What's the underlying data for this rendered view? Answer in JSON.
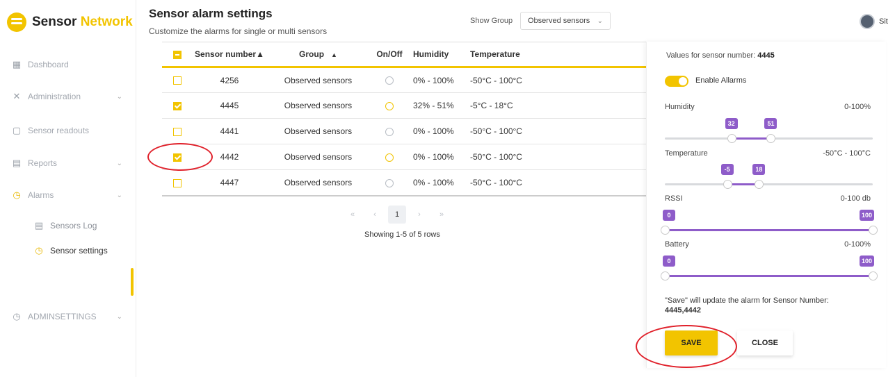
{
  "brand": {
    "name_a": "Sensor",
    "name_b": "Network",
    "accent_color": "#f2c400"
  },
  "sidebar": {
    "items": [
      {
        "label": "Dashboard",
        "icon": "dashboard-icon"
      },
      {
        "label": "Administration",
        "icon": "tools-icon"
      },
      {
        "label": "Sensor readouts",
        "icon": "chart-icon"
      },
      {
        "label": "Reports",
        "icon": "report-icon"
      },
      {
        "label": "Alarms",
        "icon": "alarm-icon"
      },
      {
        "label": "Sensors Log",
        "icon": "log-icon"
      },
      {
        "label": "Sensor settings",
        "icon": "alarm-settings-icon"
      },
      {
        "label": "ADMINSETTINGS",
        "icon": "alarm-icon"
      }
    ]
  },
  "header": {
    "title": "Sensor alarm settings",
    "subtitle": "Customize the alarms for single or multi sensors",
    "group_label": "Show Group",
    "group_value": "Observed sensors",
    "user_name": "Sit"
  },
  "table": {
    "columns": [
      "Sensor number▲",
      "Group",
      "On/Off",
      "Humidity",
      "Temperature"
    ],
    "sort_glyph": "▲",
    "rows": [
      {
        "checked": false,
        "number": "4256",
        "group": "Observed sensors",
        "alarm_on": false,
        "humidity": "0% - 100%",
        "temperature": "-50°C - 100°C"
      },
      {
        "checked": true,
        "number": "4445",
        "group": "Observed sensors",
        "alarm_on": true,
        "humidity": "32% - 51%",
        "temperature": "-5°C - 18°C"
      },
      {
        "checked": false,
        "number": "4441",
        "group": "Observed sensors",
        "alarm_on": false,
        "humidity": "0% - 100%",
        "temperature": "-50°C - 100°C"
      },
      {
        "checked": true,
        "number": "4442",
        "group": "Observed sensors",
        "alarm_on": true,
        "humidity": "0% - 100%",
        "temperature": "-50°C - 100°C"
      },
      {
        "checked": false,
        "number": "4447",
        "group": "Observed sensors",
        "alarm_on": false,
        "humidity": "0% - 100%",
        "temperature": "-50°C - 100°C"
      }
    ]
  },
  "pagination": {
    "first": "«",
    "prev": "‹",
    "current": "1",
    "next": "›",
    "last": "»",
    "showing": "Showing 1-5 of 5 rows"
  },
  "panel": {
    "values_label": "Values for sensor number: ",
    "values_number": "4445",
    "enable_label": "Enable Allarms",
    "enable_on": true,
    "humidity": {
      "label": "Humidity",
      "range": "0-100%",
      "low": "32",
      "high": "51",
      "low_frac": 0.32,
      "high_frac": 0.51
    },
    "temperature": {
      "label": "Temperature",
      "range": "-50°C - 100°C",
      "low": "-5",
      "high": "18",
      "low_frac": 0.3,
      "high_frac": 0.453
    },
    "rssi": {
      "label": "RSSI",
      "range": "0-100 db",
      "low": "0",
      "high": "100",
      "low_frac": 0.0,
      "high_frac": 1.0
    },
    "battery": {
      "label": "Battery",
      "range": "0-100%",
      "low": "0",
      "high": "100",
      "low_frac": 0.0,
      "high_frac": 1.0
    },
    "note_text": "\"Save\" will update the alarm for Sensor Number:",
    "note_numbers": "4445,4442",
    "save_label": "SAVE",
    "close_label": "CLOSE"
  }
}
